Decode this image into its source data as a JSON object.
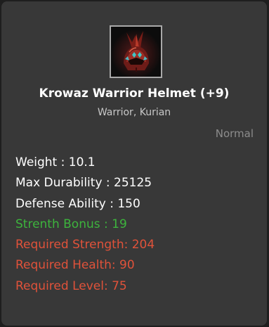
{
  "item": {
    "name": "Krowaz Warrior Helmet (+9)",
    "classes": "Warrior, Kurian",
    "grade": "Normal",
    "icon": "helmet-icon"
  },
  "stats": {
    "weight": "Weight : 10.1",
    "max_durability": "Max Durability : 25125",
    "defense_ability": "Defense Ability : 150",
    "strength_bonus": "Strenth Bonus : 19",
    "required_strength": "Required Strength: 204",
    "required_health": "Required Health: 90",
    "required_level": "Required Level: 75"
  },
  "colors": {
    "panel_background": "#383838",
    "normal_stat": "#ffffff",
    "bonus_stat": "#3db43d",
    "requirement_unmet": "#e0523a",
    "grade_text": "#8c8c8c"
  }
}
